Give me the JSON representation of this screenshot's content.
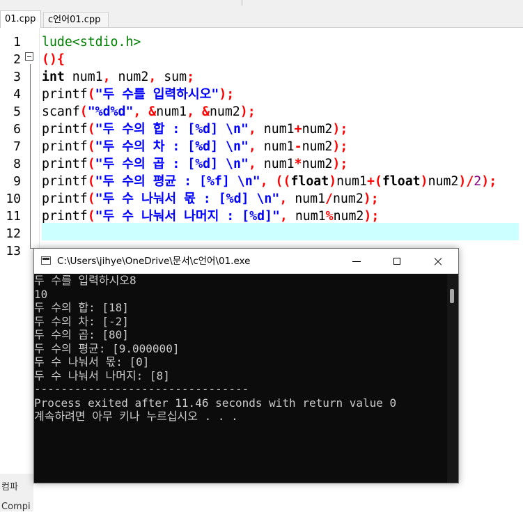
{
  "editor": {
    "tabs": [
      {
        "label": "01.cpp"
      },
      {
        "label": "c언어01.cpp"
      }
    ],
    "line_numbers": [
      "1",
      "2",
      "3",
      "4",
      "5",
      "6",
      "7",
      "8",
      "9",
      "10",
      "11",
      "12",
      "13"
    ],
    "code": {
      "l1": {
        "a": "lude<stdio.h>"
      },
      "l2": {
        "a": "(){"
      },
      "l3": {
        "a": "int",
        "b": " num1",
        "c": ",",
        "d": " num2",
        "e": ",",
        "f": " sum",
        "g": ";"
      },
      "l4": {
        "a": "printf",
        "b": "(",
        "c": "\"두 수를 입력하시오\"",
        "d": ");"
      },
      "l5": {
        "a": "scanf",
        "b": "(",
        "c": "\"%d%d\"",
        "d": ", &",
        "e": "num1",
        "f": ", &",
        "g": "num2",
        "h": ");"
      },
      "l6": {
        "a": "printf",
        "b": "(",
        "c": "\"두 수의 합 : [%d] ",
        "d": "\\n",
        "e": "\"",
        "f": ",",
        "g": " num1",
        "h": "+",
        "i": "num2",
        "j": ");"
      },
      "l7": {
        "a": "printf",
        "b": "(",
        "c": "\"두 수의 차 : [%d] ",
        "d": "\\n",
        "e": "\"",
        "f": ",",
        "g": " num1",
        "h": "-",
        "i": "num2",
        "j": ");"
      },
      "l8": {
        "a": "printf",
        "b": "(",
        "c": "\"두 수의 곱 : [%d] ",
        "d": "\\n",
        "e": "\"",
        "f": ",",
        "g": " num1",
        "h": "*",
        "i": "num2",
        "j": ");"
      },
      "l9": {
        "a": "printf",
        "b": "(",
        "c": "\"두 수의 평균 : [%f] ",
        "d": "\\n",
        "e": "\"",
        "f": ", ((",
        "g": "float",
        "h": ")",
        "i": "num1",
        "j": "+(",
        "k": "float",
        "l": ")",
        "m": "num2",
        "n": ")/",
        "o": "2",
        "p": ");"
      },
      "l10": {
        "a": "printf",
        "b": "(",
        "c": "\"두 수 나눠서 몫 : [%d] ",
        "d": "\\n",
        "e": "\"",
        "f": ",",
        "g": " num1",
        "h": "/",
        "i": "num2",
        "j": ");"
      },
      "l11": {
        "a": "printf",
        "b": "(",
        "c": "\"두 수 나눠서 나머지 : [%d]\"",
        "d": ",",
        "e": " num1",
        "f": "%",
        "g": "num2",
        "h": ");"
      }
    },
    "bottom_fragments": {
      "panel_label": "컴파",
      "status_label": "Compi"
    }
  },
  "console": {
    "title": "C:\\Users\\jihye\\OneDrive\\문서\\c언어\\01.exe",
    "lines": [
      "두 수를 입력하시오8",
      "10",
      "두 수의 합: [18]",
      "두 수의 차: [-2]",
      "두 수의 곱: [80]",
      "두 수의 평균: [9.000000]",
      "두 수 나눠서 몫: [0]",
      "두 수 나눠서 나머지: [8]",
      "--------------------------------",
      "Process exited after 11.46 seconds with return value 0",
      "계속하려면 아무 키나 누르십시오 . . ."
    ]
  },
  "colors": {
    "keyword": "#000000",
    "operator": "#ff0000",
    "string": "#0000ff",
    "preprocessor": "#008000",
    "number": "#800080",
    "current_line": "#ccffff",
    "console_bg": "#0c0c0c",
    "console_text": "#cccccc"
  }
}
